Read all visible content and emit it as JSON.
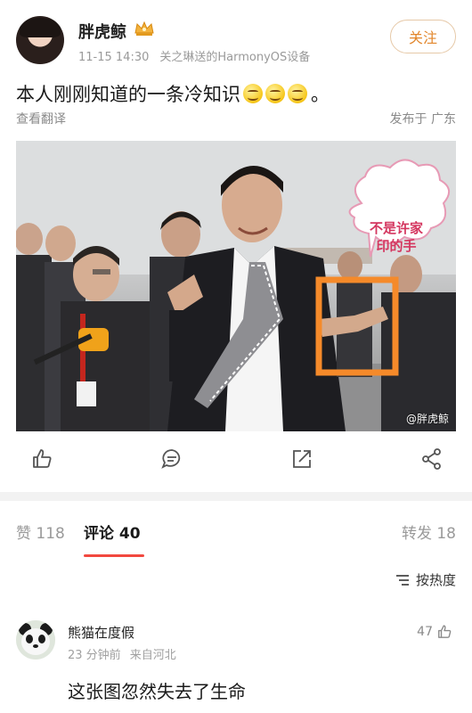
{
  "post": {
    "username": "胖虎鲸",
    "time": "11-15 14:30",
    "device": "关之琳送的HarmonyOS设备",
    "follow_label": "关注",
    "text": "本人刚刚知道的一条冷知识",
    "text_end": "。",
    "emoji_icons": [
      "smile-emoji",
      "smile-emoji",
      "smile-emoji"
    ],
    "translate_label": "查看翻译",
    "location": "发布于 广东",
    "image": {
      "bubble_text": "不是许家印的手",
      "watermark": "@胖虎鲸",
      "highlight_color": "#f58a2a"
    }
  },
  "action_bar": [
    "like-icon",
    "comment-icon",
    "repost-icon",
    "share-icon"
  ],
  "tabs": {
    "likes": "赞 118",
    "comments": "评论 40",
    "reposts": "转发 18"
  },
  "sort_label": "按热度",
  "comment": {
    "author": "熊猫在度假",
    "time": "23 分钟前",
    "from": "来自河北",
    "likes": "47",
    "text": "这张图忽然失去了生命"
  },
  "colors": {
    "accent": "#f2483f",
    "follow": "#e2862b",
    "meta": "#9a9a9a"
  }
}
